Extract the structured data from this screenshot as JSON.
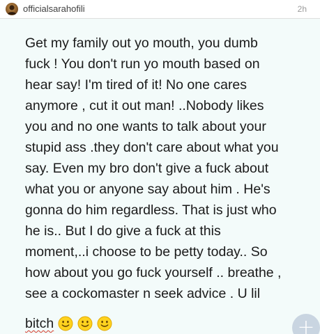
{
  "header": {
    "username": "officialsarahofili",
    "timestamp": "2h",
    "avatar_icon": "profile-photo"
  },
  "note": {
    "text": "Get my family out yo mouth, you dumb\nfuck ! You don't run yo mouth based on\nhear say! I'm tired of it!  No one cares\nanymore , cut it out man! ..Nobody likes\nyou and no one wants to talk about your\nstupid ass .they don't care about what you\nsay. Even my bro don't  give a fuck about\nwhat you or anyone say about him . He's\ngonna do him regardless. That is just who\nhe is.. But I do give a fuck at this\nmoment,..i choose to be petty today.. So\nhow about you go fuck yourself .. breathe ,\nsee a cockomaster n seek advice . U lil",
    "last_word": "bitch",
    "emojis": [
      "slightly-smiling-face",
      "slightly-smiling-face",
      "slightly-smiling-face"
    ]
  },
  "fab": {
    "icon": "plus-icon",
    "label": "+"
  },
  "colors": {
    "note_background": "#f3fbfa",
    "text": "#1b1b1b",
    "emoji_yellow": "#ffd21f",
    "spellcheck_underline": "#d43a2a",
    "fab_background": "#c7d3e0"
  }
}
